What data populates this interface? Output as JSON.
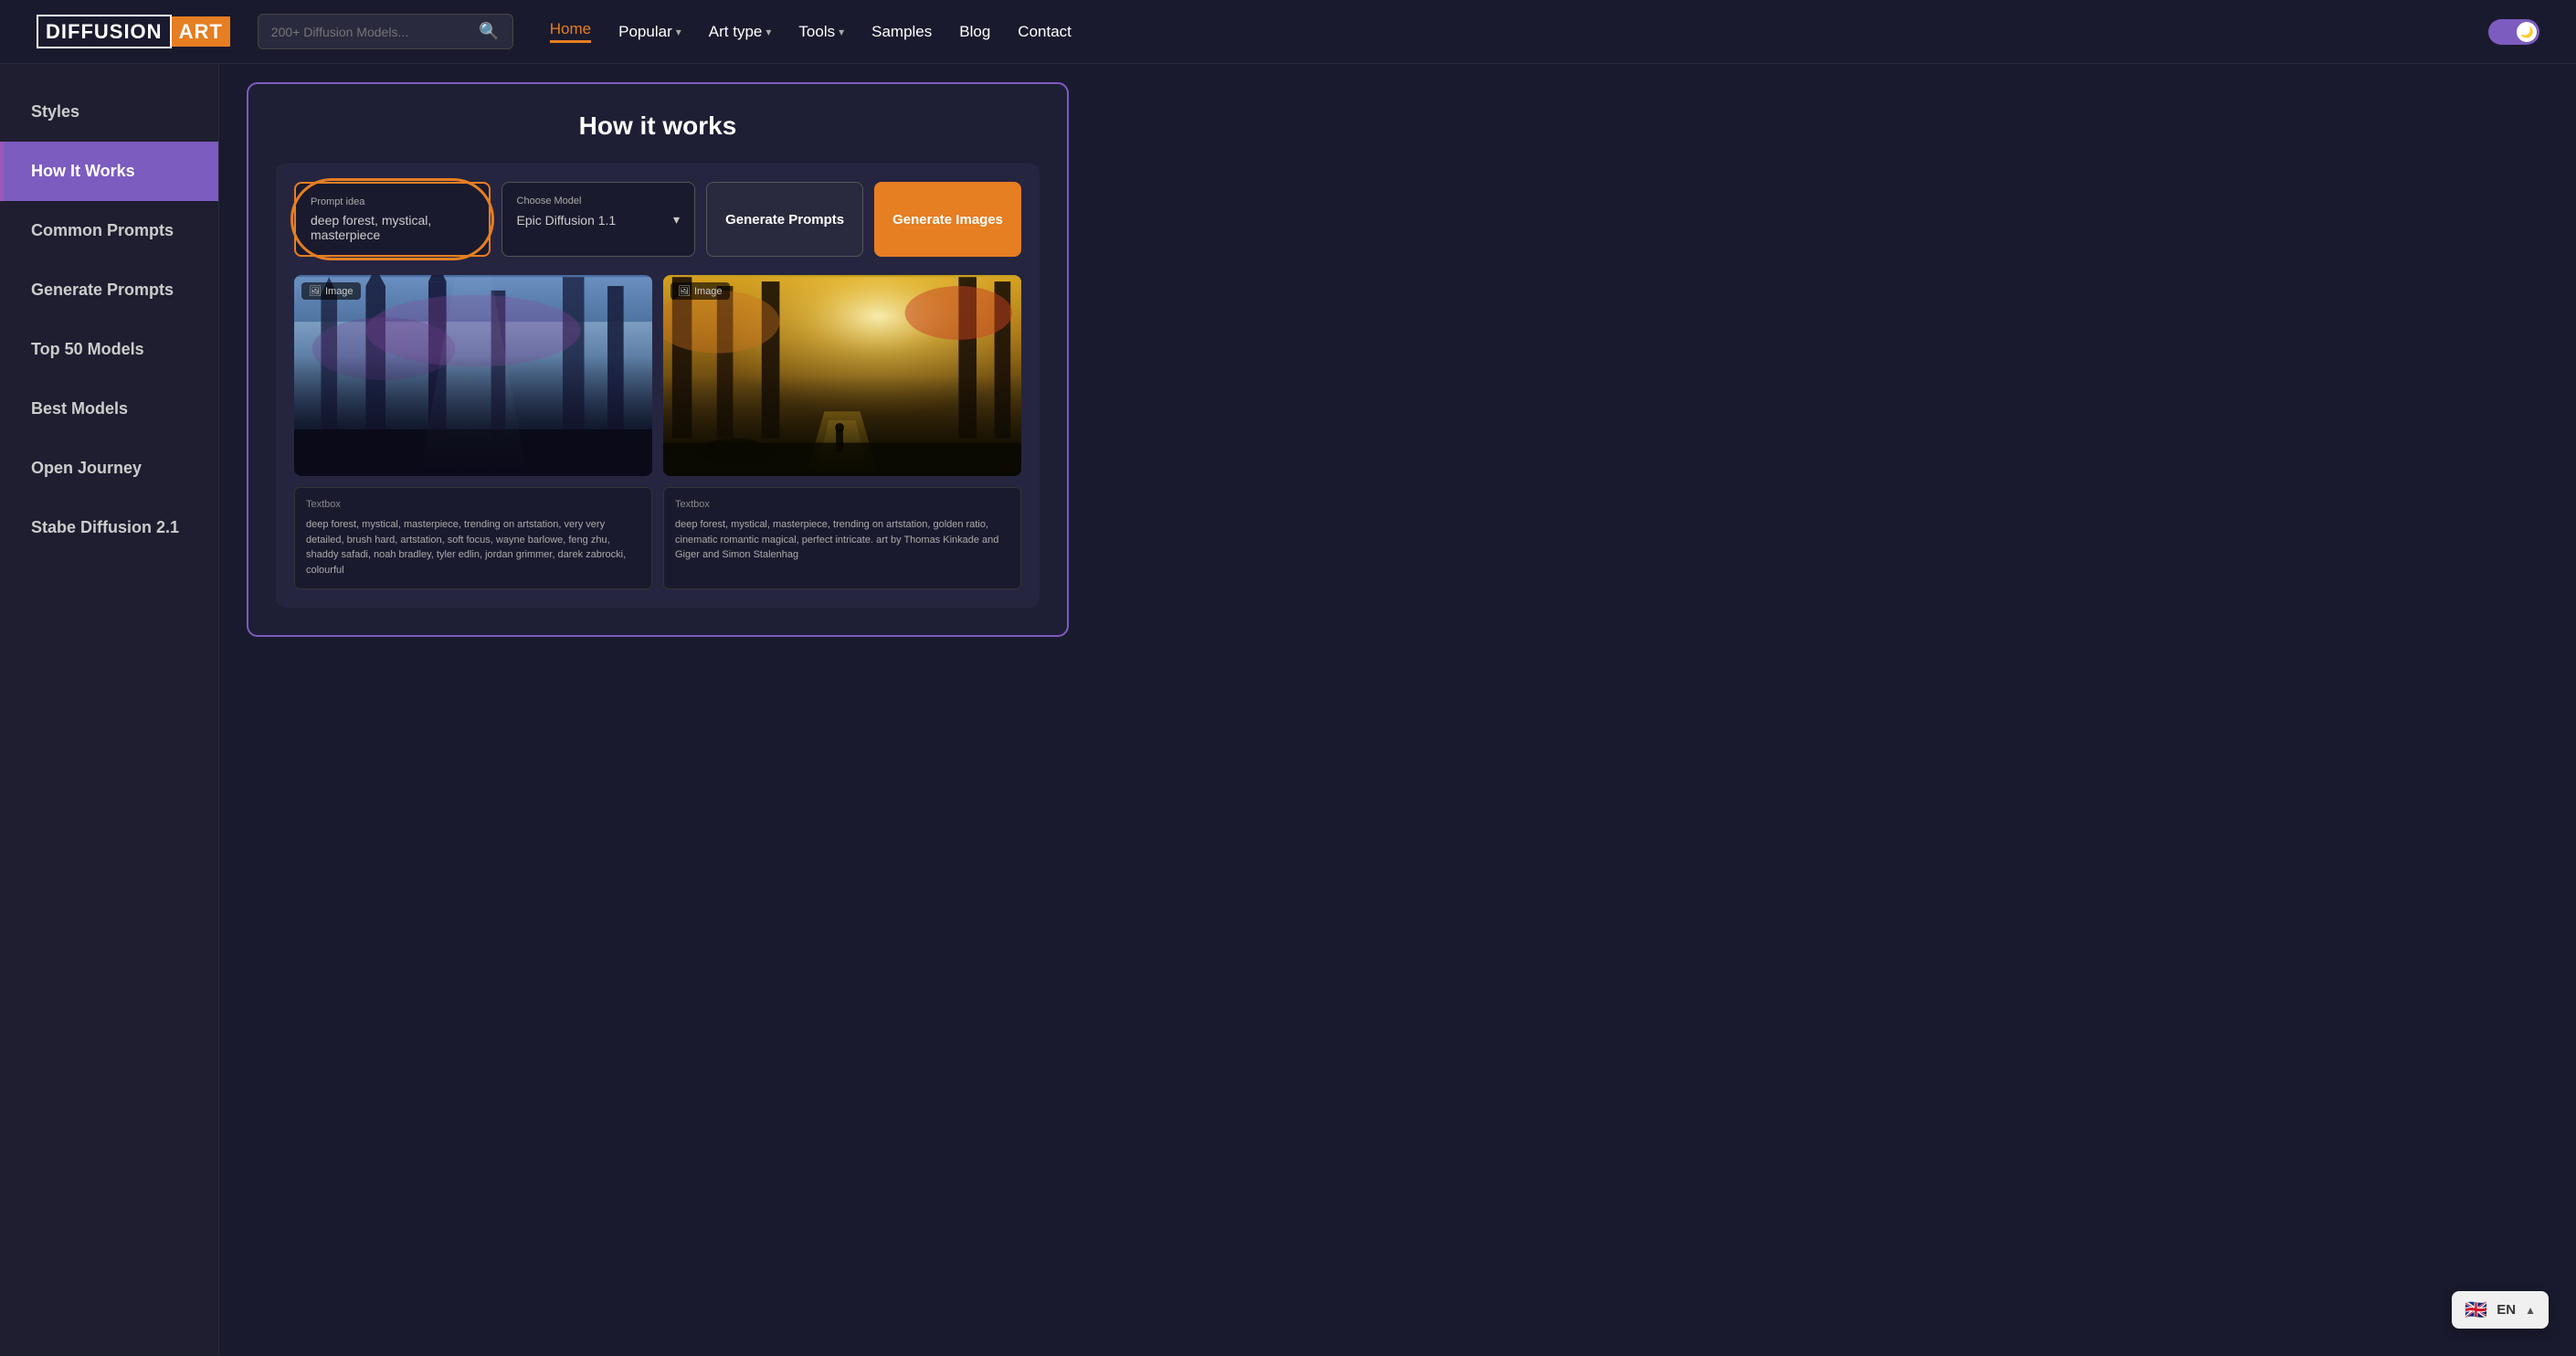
{
  "logo": {
    "diffusion": "DIFFUSION",
    "art": "ART"
  },
  "search": {
    "placeholder": "200+ Diffusion Models..."
  },
  "nav": {
    "items": [
      {
        "label": "Home",
        "active": true
      },
      {
        "label": "Popular",
        "hasDropdown": true
      },
      {
        "label": "Art type",
        "hasDropdown": true
      },
      {
        "label": "Tools",
        "hasDropdown": true
      },
      {
        "label": "Samples"
      },
      {
        "label": "Blog"
      },
      {
        "label": "Contact"
      }
    ]
  },
  "sidebar": {
    "items": [
      {
        "label": "Styles",
        "active": false
      },
      {
        "label": "How It Works",
        "active": true
      },
      {
        "label": "Common Prompts",
        "active": false
      },
      {
        "label": "Generate Prompts",
        "active": false
      },
      {
        "label": "Top 50 Models",
        "active": false
      },
      {
        "label": "Best Models",
        "active": false
      },
      {
        "label": "Open Journey",
        "active": false
      },
      {
        "label": "Stabe Diffusion 2.1",
        "active": false
      }
    ]
  },
  "how_it_works": {
    "title": "How it works",
    "prompt_idea_label": "Prompt idea",
    "prompt_value": "deep forest, mystical, masterpiece",
    "choose_model_label": "Choose Model",
    "model_value": "Epic Diffusion 1.1",
    "btn_generate_prompts": "Generate Prompts",
    "btn_generate_images": "Generate Images",
    "image_label_left": "Image",
    "image_label_right": "Image",
    "textbox_label_left": "Textbox",
    "textbox_label_right": "Textbox",
    "textbox_content_left": "deep forest, mystical, masterpiece, trending on artstation, very very detailed, brush hard, artstation, soft focus, wayne barlowe, feng zhu, shaddy safadi, noah bradley, tyler edlin, jordan grimmer, darek zabrocki, colourful",
    "textbox_content_right": "deep forest, mystical, masterpiece, trending on artstation, golden ratio, cinematic romantic magical, perfect intricate. art by Thomas Kinkade and Giger and Simon Stalenhag"
  },
  "lang": {
    "code": "EN",
    "flag": "🇬🇧"
  }
}
